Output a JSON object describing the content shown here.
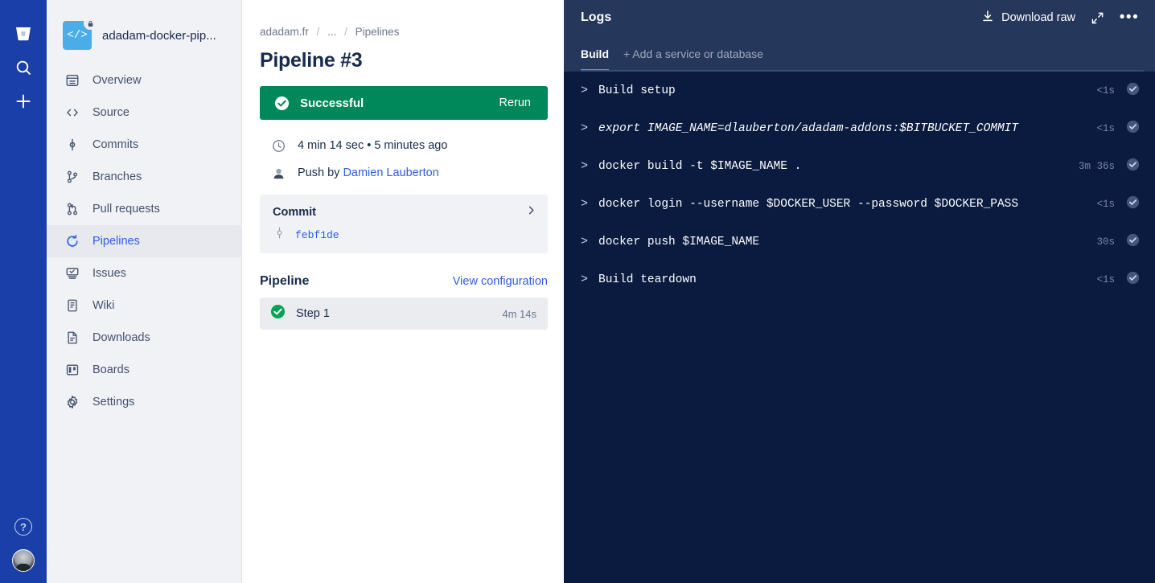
{
  "rail": {
    "logo_icon": "bitbucket-logo-icon",
    "items": [
      {
        "icon": "search-icon",
        "name": "search"
      },
      {
        "icon": "plus-icon",
        "name": "create"
      }
    ],
    "help_label": "?",
    "avatar_name": "user-avatar"
  },
  "sidebar": {
    "repo": {
      "name": "adadam-docker-pip...",
      "icon_glyph": "</>",
      "badge_icon": "lock-icon"
    },
    "items": [
      {
        "label": "Overview",
        "icon": "overview-icon",
        "active": false
      },
      {
        "label": "Source",
        "icon": "source-code-icon",
        "active": false
      },
      {
        "label": "Commits",
        "icon": "commits-icon",
        "active": false
      },
      {
        "label": "Branches",
        "icon": "branches-icon",
        "active": false
      },
      {
        "label": "Pull requests",
        "icon": "pull-request-icon",
        "active": false
      },
      {
        "label": "Pipelines",
        "icon": "pipelines-icon",
        "active": true
      },
      {
        "label": "Issues",
        "icon": "issues-icon",
        "active": false
      },
      {
        "label": "Wiki",
        "icon": "wiki-icon",
        "active": false
      },
      {
        "label": "Downloads",
        "icon": "downloads-icon",
        "active": false
      },
      {
        "label": "Boards",
        "icon": "boards-icon",
        "active": false
      },
      {
        "label": "Settings",
        "icon": "gear-icon",
        "active": false
      }
    ]
  },
  "main": {
    "breadcrumb": {
      "root": "adadam.fr",
      "ellipsis": "...",
      "current": "Pipelines",
      "separator": "/"
    },
    "title": "Pipeline #3",
    "status": {
      "label": "Successful",
      "action": "Rerun",
      "icon": "check-circle-icon",
      "color": "#00875A"
    },
    "duration_line": "4 min 14 sec • 5 minutes ago",
    "duration_icon": "clock-icon",
    "trigger_prefix": "Push by",
    "trigger_author": "Damien Lauberton",
    "trigger_icon": "push-avatar-icon",
    "commit": {
      "label": "Commit",
      "hash": "febf1de",
      "chevron_icon": "chevron-right-icon",
      "branch_icon": "commit-node-icon"
    },
    "pipeline": {
      "label": "Pipeline",
      "view_config": "View configuration",
      "steps": [
        {
          "name": "Step 1",
          "time": "4m 14s",
          "icon": "check-circle-icon",
          "status": "success"
        }
      ]
    }
  },
  "logs": {
    "title": "Logs",
    "download_label": "Download raw",
    "download_icon": "download-icon",
    "expand_icon": "expand-icon",
    "more_icon": "more-horizontal-icon",
    "tabs": [
      {
        "label": "Build",
        "active": true
      },
      {
        "label": "+ Add a service or database",
        "active": false
      }
    ],
    "lines": [
      {
        "chevron": ">",
        "command": "Build setup",
        "time": "<1s",
        "status": "success",
        "italic": false
      },
      {
        "chevron": ">",
        "command": "export IMAGE_NAME=dlauberton/adadam-addons:$BITBUCKET_COMMIT",
        "time": "<1s",
        "status": "success",
        "italic": true
      },
      {
        "chevron": ">",
        "command": "docker build -t $IMAGE_NAME .",
        "time": "3m 36s",
        "status": "success",
        "italic": false
      },
      {
        "chevron": ">",
        "command": "docker login --username $DOCKER_USER --password $DOCKER_PASS",
        "time": "<1s",
        "status": "success",
        "italic": false
      },
      {
        "chevron": ">",
        "command": "docker push $IMAGE_NAME",
        "time": "30s",
        "status": "success",
        "italic": false
      },
      {
        "chevron": ">",
        "command": "Build teardown",
        "time": "<1s",
        "status": "success",
        "italic": false
      }
    ]
  },
  "colors": {
    "rail_blue": "#1B3FA8",
    "sidebar_grey": "#F1F2F6",
    "success_green": "#00875A",
    "link_blue": "#2F5CE5",
    "logs_bg": "#0A1B3F",
    "logs_header": "#25375B",
    "tab_accent": "#4C9AFF",
    "repo_icon_blue": "#4BADE8"
  }
}
